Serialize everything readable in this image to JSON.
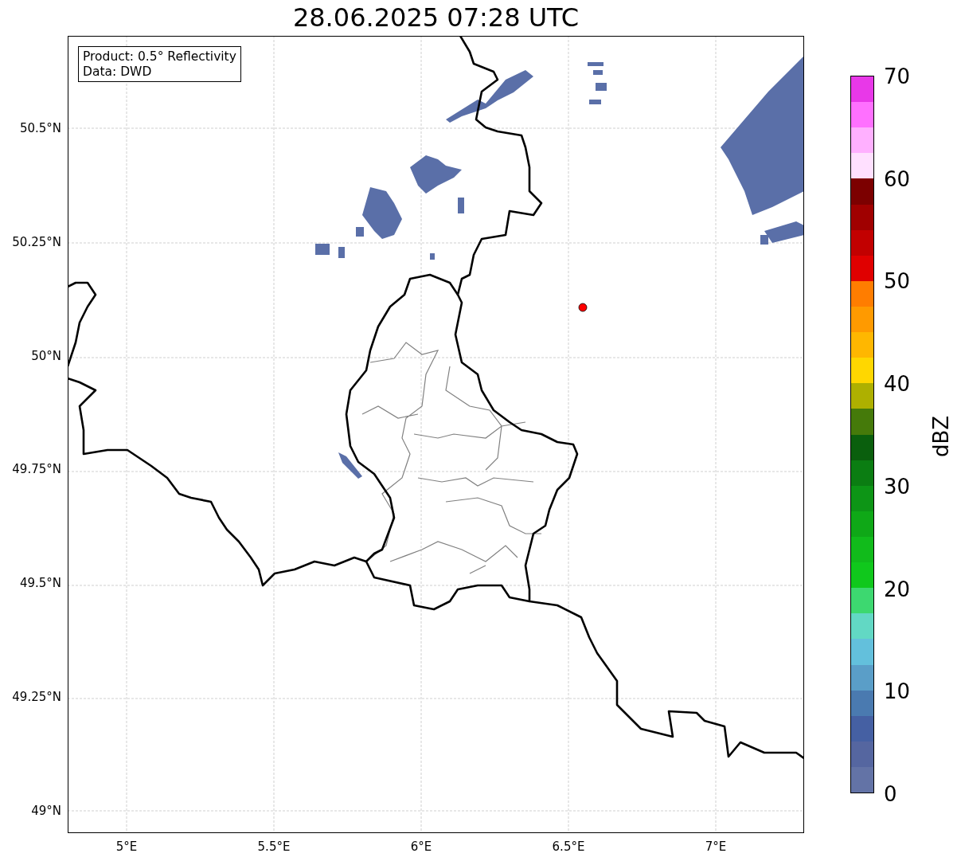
{
  "title": "28.06.2025 07:28 UTC",
  "map": {
    "legend": [
      "Product: 0.5° Reflectivity",
      "Data: DWD"
    ],
    "x_ticks": [
      "5°E",
      "5.5°E",
      "6°E",
      "6.5°E",
      "7°E"
    ],
    "y_ticks": [
      "50.5°N",
      "50.25°N",
      "50°N",
      "49.75°N",
      "49.5°N",
      "49.25°N",
      "49°N"
    ]
  },
  "colorbar": {
    "label": "dBZ",
    "ticks": [
      "70",
      "60",
      "50",
      "40",
      "30",
      "20",
      "10",
      "0"
    ],
    "bands": [
      {
        "color": "#e838e8"
      },
      {
        "color": "#ff70ff"
      },
      {
        "color": "#ffb0ff"
      },
      {
        "color": "#ffe0ff"
      },
      {
        "color": "#7c0000"
      },
      {
        "color": "#a00000"
      },
      {
        "color": "#c20000"
      },
      {
        "color": "#e00000"
      },
      {
        "color": "#ff7d00"
      },
      {
        "color": "#ff9a00"
      },
      {
        "color": "#ffb700"
      },
      {
        "color": "#ffd700"
      },
      {
        "color": "#aeb000"
      },
      {
        "color": "#457a0a"
      },
      {
        "color": "#0a5f0d"
      },
      {
        "color": "#0b7d12"
      },
      {
        "color": "#0d9516"
      },
      {
        "color": "#0fa817"
      },
      {
        "color": "#11bb1b"
      },
      {
        "color": "#10c81c"
      },
      {
        "color": "#3dd870"
      },
      {
        "color": "#62d8c4"
      },
      {
        "color": "#63c0dc"
      },
      {
        "color": "#5a9ec8"
      },
      {
        "color": "#4a7ab0"
      },
      {
        "color": "#4560a3"
      },
      {
        "color": "#5566a0"
      },
      {
        "color": "#6373a6"
      }
    ]
  }
}
